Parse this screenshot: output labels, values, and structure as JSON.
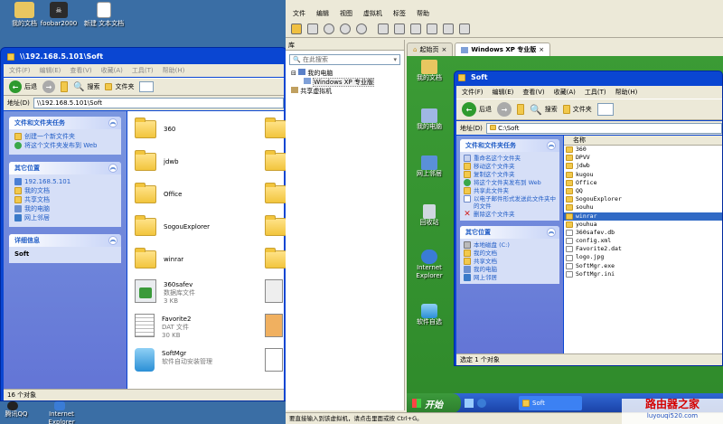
{
  "host_desktop": {
    "icons": [
      {
        "label": "我的文档",
        "icon": "my-documents-icon",
        "color": "#e8c660"
      },
      {
        "label": "foobar2000",
        "icon": "foobar-icon",
        "color": "#2b2b2b"
      },
      {
        "label": "新建 文本文档",
        "icon": "text-file-icon",
        "color": "#ffffff"
      }
    ],
    "bottom_icons": [
      {
        "label": "腾讯QQ",
        "icon": "qq-icon"
      },
      {
        "label": "Internet Explorer",
        "icon": "ie-icon"
      }
    ]
  },
  "left_explorer": {
    "title": "\\\\192.168.5.101\\Soft",
    "menu": [
      "文件(F)",
      "编辑(E)",
      "查看(V)",
      "收藏(A)",
      "工具(T)",
      "帮助(H)"
    ],
    "toolbar": {
      "back": "后退",
      "search": "搜索",
      "folders": "文件夹"
    },
    "address_label": "地址(D)",
    "address_value": "\\\\192.168.5.101\\Soft",
    "panels": [
      {
        "title": "文件和文件夹任务",
        "items": [
          {
            "label": "创建一个新文件夹",
            "icon": "new-folder-icon"
          },
          {
            "label": "将这个文件夹发布到 Web",
            "icon": "web-publish-icon"
          }
        ]
      },
      {
        "title": "其它位置",
        "items": [
          {
            "label": "192.168.5.101",
            "icon": "network-computer-icon"
          },
          {
            "label": "我的文档",
            "icon": "my-documents-icon"
          },
          {
            "label": "共享文档",
            "icon": "shared-documents-icon"
          },
          {
            "label": "我的电脑",
            "icon": "my-computer-icon"
          },
          {
            "label": "网上邻居",
            "icon": "network-places-icon"
          }
        ]
      },
      {
        "title": "详细信息",
        "items": [
          {
            "label": "Soft",
            "icon": ""
          }
        ]
      }
    ],
    "files": [
      {
        "name": "360",
        "type": "",
        "size": "",
        "kind": "folder"
      },
      {
        "name": "jdwb",
        "type": "",
        "size": "",
        "kind": "folder"
      },
      {
        "name": "Office",
        "type": "",
        "size": "",
        "kind": "folder"
      },
      {
        "name": "SogouExplorer",
        "type": "",
        "size": "",
        "kind": "folder"
      },
      {
        "name": "winrar",
        "type": "",
        "size": "",
        "kind": "folder"
      },
      {
        "name": "360safev",
        "type": "数据库文件",
        "size": "3 KB",
        "kind": "db"
      },
      {
        "name": "Favorite2",
        "type": "DAT 文件",
        "size": "30 KB",
        "kind": "dat"
      },
      {
        "name": "SoftMgr",
        "type": "软件自动安装管理",
        "size": "",
        "kind": "exe"
      }
    ],
    "status": "16 个对象"
  },
  "vm": {
    "menu": [
      "文件",
      "编辑",
      "视图",
      "虚拟机",
      "标签",
      "帮助"
    ],
    "library_title": "库",
    "search_placeholder": "在此搜索",
    "tree": {
      "root": "我的电脑",
      "child": "Windows XP 专业版",
      "shared": "共享虚拟机"
    },
    "tabs": [
      {
        "label": "起始页",
        "active": false
      },
      {
        "label": "Windows XP 专业版",
        "active": true
      }
    ],
    "status": "要直接输入到该虚拟机，请点击里面或按 Ctrl+G。"
  },
  "guest": {
    "desktop_icons": [
      {
        "label": "我的文档",
        "icon": "my-documents-icon"
      },
      {
        "label": "我的电脑",
        "icon": "my-computer-icon"
      },
      {
        "label": "网上邻居",
        "icon": "network-places-icon"
      },
      {
        "label": "回收站",
        "icon": "recycle-bin-icon"
      },
      {
        "label": "Internet Explorer",
        "icon": "ie-icon"
      },
      {
        "label": "软件自选",
        "icon": "software-select-icon"
      }
    ],
    "explorer": {
      "title": "Soft",
      "menu": [
        "文件(F)",
        "编辑(E)",
        "查看(V)",
        "收藏(A)",
        "工具(T)",
        "帮助(H)"
      ],
      "toolbar": {
        "back": "后退",
        "search": "搜索",
        "folders": "文件夹"
      },
      "address_label": "地址(D)",
      "address_value": "C:\\Soft",
      "panel1": {
        "title": "文件和文件夹任务",
        "items": [
          "重命名这个文件夹",
          "移动这个文件夹",
          "复制这个文件夹",
          "将这个文件夹发布到 Web",
          "共享此文件夹",
          "以电子邮件形式发送此文件夹中的文件",
          "删除这个文件夹"
        ]
      },
      "panel2": {
        "title": "其它位置",
        "items": [
          "本地磁盘 (C:)",
          "我的文档",
          "共享文档",
          "我的电脑",
          "网上邻居"
        ]
      },
      "list_header": "名称",
      "files": [
        {
          "name": "360",
          "kind": "folder"
        },
        {
          "name": "DPVV",
          "kind": "folder"
        },
        {
          "name": "jdwb",
          "kind": "folder"
        },
        {
          "name": "kugou",
          "kind": "folder"
        },
        {
          "name": "Office",
          "kind": "folder"
        },
        {
          "name": "QQ",
          "kind": "folder"
        },
        {
          "name": "SogouExplorer",
          "kind": "folder"
        },
        {
          "name": "souhu",
          "kind": "folder"
        },
        {
          "name": "winrar",
          "kind": "folder",
          "selected": true
        },
        {
          "name": "youhua",
          "kind": "folder"
        },
        {
          "name": "360safev.db",
          "kind": "file"
        },
        {
          "name": "config.xml",
          "kind": "file"
        },
        {
          "name": "Favorite2.dat",
          "kind": "file"
        },
        {
          "name": "logo.jpg",
          "kind": "file"
        },
        {
          "name": "SoftMgr.exe",
          "kind": "file"
        },
        {
          "name": "SoftMgr.ini",
          "kind": "file"
        }
      ],
      "status": "选定 1 个对象"
    },
    "start_label": "开始",
    "task_button": "Soft"
  },
  "watermark": {
    "title": "路由器之家",
    "url": "luyouqi520.com"
  }
}
